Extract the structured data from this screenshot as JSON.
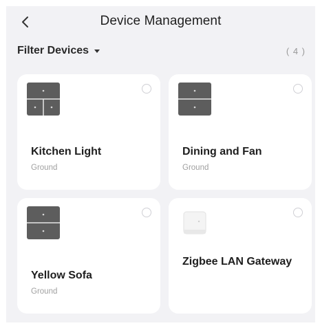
{
  "header": {
    "title": "Device Management",
    "back_icon": "chevron-left-icon"
  },
  "filter": {
    "label": "Filter Devices",
    "icon": "caret-down-icon",
    "count": "( 4 )"
  },
  "devices": [
    {
      "name": "Kitchen Light",
      "room": "Ground",
      "icon": "three-gang-switch-icon",
      "selected": false
    },
    {
      "name": "Dining and Fan",
      "room": "Ground",
      "icon": "two-gang-switch-icon",
      "selected": false
    },
    {
      "name": "Yellow Sofa",
      "room": "Ground",
      "icon": "two-gang-switch-icon",
      "selected": false
    },
    {
      "name": "Zigbee LAN Gateway",
      "room": "",
      "icon": "gateway-icon",
      "selected": false
    }
  ],
  "colors": {
    "background": "#f2f2f5",
    "card": "#ffffff",
    "switch_panel": "#5d5d5d"
  }
}
